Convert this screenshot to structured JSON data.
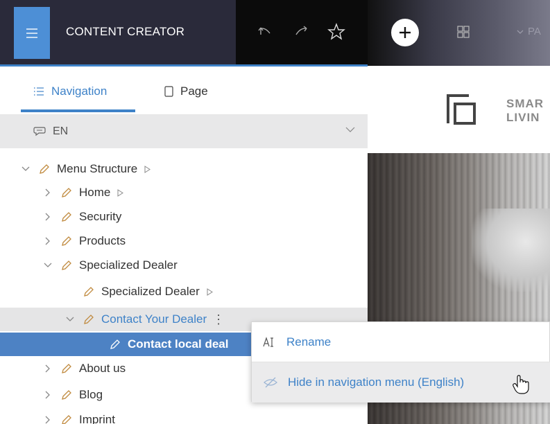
{
  "app": {
    "title": "CONTENT CREATOR"
  },
  "toolbar": {
    "icons": [
      "menu-icon",
      "undo-icon",
      "redo-icon",
      "star-icon",
      "plus-icon",
      "grid-icon"
    ],
    "page_dropdown": "PA"
  },
  "tabs": [
    {
      "label": "Navigation",
      "icon": "list-icon",
      "active": true
    },
    {
      "label": "Page",
      "icon": "page-icon",
      "active": false
    }
  ],
  "language": {
    "value": "EN"
  },
  "tree": [
    {
      "label": "Menu Structure",
      "level": 0,
      "expanded": true,
      "has_play": true
    },
    {
      "label": "Home",
      "level": 1,
      "expanded": false,
      "has_play": true
    },
    {
      "label": "Security",
      "level": 1,
      "expanded": false
    },
    {
      "label": "Products",
      "level": 1,
      "expanded": false
    },
    {
      "label": "Specialized Dealer",
      "level": 1,
      "expanded": true
    },
    {
      "label": "Specialized Dealer",
      "level": 2,
      "leaf": true,
      "has_play": true
    },
    {
      "label": "Contact Your Dealer",
      "level": 2,
      "expanded": true,
      "hover": true
    },
    {
      "label": "Contact local deal",
      "level": 3,
      "leaf": true,
      "selected": true
    },
    {
      "label": "About us",
      "level": 1,
      "expanded": false
    },
    {
      "label": "Blog",
      "level": 1,
      "expanded": false
    },
    {
      "label": "Imprint",
      "level": 1,
      "expanded": false
    }
  ],
  "context_menu": {
    "items": [
      {
        "label": "Rename",
        "icon": "rename-icon"
      },
      {
        "label": "Hide in navigation menu (English)",
        "icon": "eye-slash-icon"
      }
    ]
  },
  "preview": {
    "logo_line1": "SMAR",
    "logo_line2": "LIVIN"
  },
  "colors": {
    "accent": "#3e82c8",
    "selected_bg": "#4d82c4",
    "topbar_dark": "#2a2a3a"
  }
}
